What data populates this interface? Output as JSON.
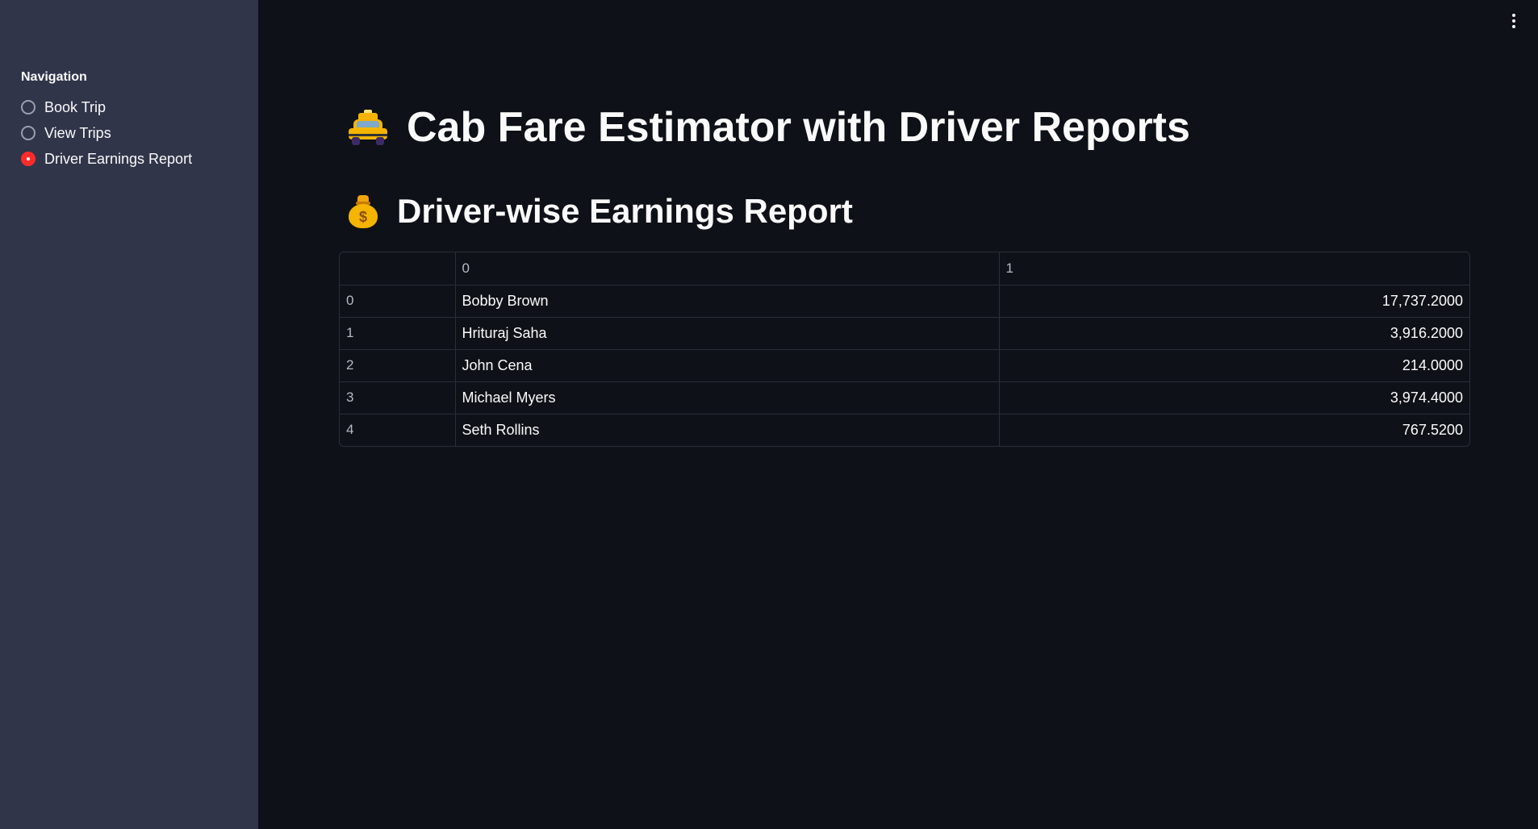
{
  "sidebar": {
    "nav_label": "Navigation",
    "options": [
      {
        "label": "Book Trip",
        "selected": false
      },
      {
        "label": "View Trips",
        "selected": false
      },
      {
        "label": "Driver Earnings Report",
        "selected": true
      }
    ]
  },
  "header": {
    "menu_icon": "vertical-ellipsis-icon"
  },
  "main": {
    "title": "Cab Fare Estimator with Driver Reports",
    "title_icon": "taxi-icon",
    "subtitle": "Driver-wise Earnings Report",
    "subtitle_icon": "money-bag-icon",
    "table": {
      "columns": [
        "",
        "0",
        "1"
      ],
      "rows": [
        {
          "index": "0",
          "name": "Bobby Brown",
          "value": "17,737.2000"
        },
        {
          "index": "1",
          "name": "Hrituraj Saha",
          "value": "3,916.2000"
        },
        {
          "index": "2",
          "name": "John Cena",
          "value": "214.0000"
        },
        {
          "index": "3",
          "name": "Michael Myers",
          "value": "3,974.4000"
        },
        {
          "index": "4",
          "name": "Seth Rollins",
          "value": "767.5200"
        }
      ]
    }
  },
  "colors": {
    "background": "#0e1117",
    "sidebar": "#31354a",
    "accent": "#ff2b2b"
  }
}
